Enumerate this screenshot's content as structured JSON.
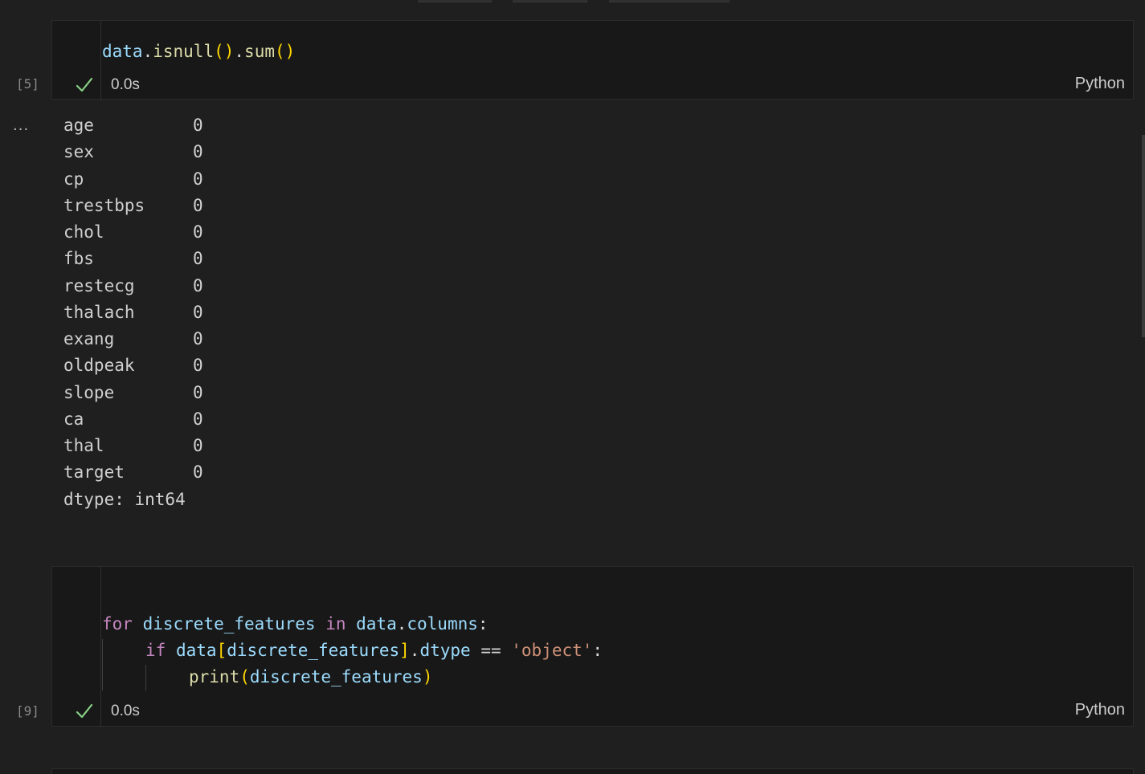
{
  "cell1": {
    "exec_count": "[5]",
    "code_line": "data.isnull().sum()",
    "code_tokens": {
      "v1": "data",
      "d1": ".",
      "f1": "isnull",
      "p1": "()",
      "d2": ".",
      "f2": "sum",
      "p2": "()"
    },
    "status_time": "0.0s",
    "language": "Python",
    "status_icon": "check-icon",
    "status_color": "#89d185"
  },
  "output1": {
    "more_label": "...",
    "rows": [
      {
        "name": "age",
        "value": "0"
      },
      {
        "name": "sex",
        "value": "0"
      },
      {
        "name": "cp",
        "value": "0"
      },
      {
        "name": "trestbps",
        "value": "0"
      },
      {
        "name": "chol",
        "value": "0"
      },
      {
        "name": "fbs",
        "value": "0"
      },
      {
        "name": "restecg",
        "value": "0"
      },
      {
        "name": "thalach",
        "value": "0"
      },
      {
        "name": "exang",
        "value": "0"
      },
      {
        "name": "oldpeak",
        "value": "0"
      },
      {
        "name": "slope",
        "value": "0"
      },
      {
        "name": "ca",
        "value": "0"
      },
      {
        "name": "thal",
        "value": "0"
      },
      {
        "name": "target",
        "value": "0"
      }
    ],
    "dtype": "dtype: int64"
  },
  "cell2": {
    "exec_count": "[9]",
    "lines": [
      {
        "kw": "for",
        "sp1": " ",
        "var1": "discrete_features",
        "sp2": " ",
        "kw2": "in",
        "sp3": " ",
        "var2": "data",
        "dot": ".",
        "var3": "columns",
        "colon": ":"
      },
      {
        "kw": "if",
        "sp1": " ",
        "var1": "data",
        "lb": "[",
        "var2": "discrete_features",
        "rb": "]",
        "dot": ".",
        "var3": "dtype",
        "sp2": " ",
        "op": "==",
        "sp3": " ",
        "str": "'object'",
        "colon": ":"
      },
      {
        "fn": "print",
        "lp": "(",
        "var": "discrete_features",
        "rp": ")"
      }
    ],
    "status_time": "0.0s",
    "language": "Python",
    "status_icon": "check-icon"
  },
  "colors": {
    "background": "#1f1f1f",
    "cell_background": "#181818",
    "keyword": "#c586c0",
    "variable": "#9cdcfe",
    "function": "#dcdcaa",
    "bracket": "#ffd700",
    "string": "#ce9178",
    "success": "#89d185"
  }
}
